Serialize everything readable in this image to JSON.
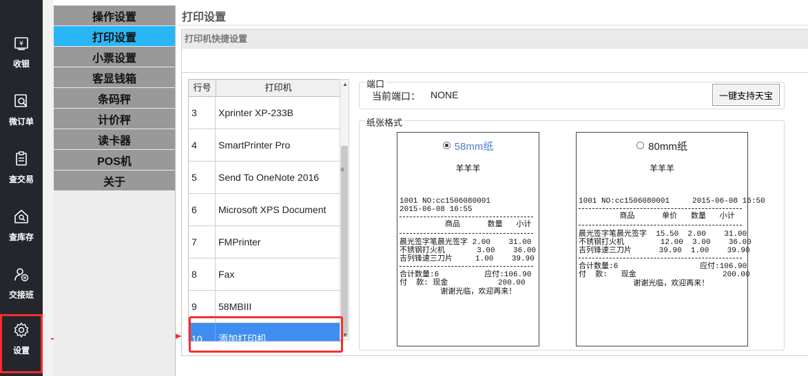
{
  "nav": {
    "items": [
      {
        "label": "收银",
        "icon": "cashier-icon"
      },
      {
        "label": "微订单",
        "icon": "order-search-icon"
      },
      {
        "label": "查交易",
        "icon": "clipboard-icon"
      },
      {
        "label": "查库存",
        "icon": "house-search-icon"
      },
      {
        "label": "交接班",
        "icon": "user-shift-icon"
      },
      {
        "label": "设置",
        "icon": "gear-icon"
      }
    ]
  },
  "categories": [
    "操作设置",
    "打印设置",
    "小票设置",
    "客显钱箱",
    "条码秤",
    "计价秤",
    "读卡器",
    "POS机",
    "关于"
  ],
  "active_category": "打印设置",
  "page": {
    "title": "打印设置",
    "quick_settings": "打印机快捷设置"
  },
  "printers": {
    "headers": {
      "no": "行号",
      "name": "打印机"
    },
    "rows": [
      {
        "no": "3",
        "name": "Xprinter XP-233B"
      },
      {
        "no": "4",
        "name": "SmartPrinter Pro"
      },
      {
        "no": "5",
        "name": "Send To OneNote 2016"
      },
      {
        "no": "6",
        "name": "Microsoft XPS Document"
      },
      {
        "no": "7",
        "name": "FMPrinter"
      },
      {
        "no": "8",
        "name": "Fax"
      },
      {
        "no": "9",
        "name": "58MBIII"
      },
      {
        "no": "10",
        "name": "添加打印机"
      }
    ],
    "selected": "10"
  },
  "port": {
    "group_title": "端口",
    "label": "当前端口：",
    "value": "NONE",
    "button": "一键支持天宝"
  },
  "paper": {
    "group_title": "纸张格式",
    "options": [
      {
        "label": "58mm纸",
        "selected": true,
        "shop": "羊羊羊",
        "line1": "1001 NO:cc1506080001",
        "line2": "2015-06-08 16:55",
        "header": "          商品      数量   小计",
        "items": [
          "晨光签字笔晨光签字 2.00    31.00",
          "不锈钢打火机       3.00    36.00",
          "吉列锋速三刀片     1.00    39.90"
        ],
        "total1": "合计数量:6          应付:106.90",
        "total2": "付  款: 现金           200.00",
        "thanks": "         谢谢光临，欢迎再来！"
      },
      {
        "label": "80mm纸",
        "selected": false,
        "shop": "羊羊羊",
        "line1": "1001 NO:cc1506080001     2015-06-08 16:50",
        "header": "         商品      单价   数量   小计",
        "items": [
          "晨光签字笔晨光签字  15.50  2.00    31.00",
          "不锈钢打火机        12.00  3.00    36.00",
          "吉列锋速三刀片      39.90  1.00    39.90"
        ],
        "total1": "合计数量:6                  应付:106.90",
        "total2": "付  款:   现金                   200.00",
        "thanks": "            谢谢光临，欢迎再来！"
      }
    ]
  },
  "colors": {
    "nav_bg": "#23262d",
    "active_category": "#29b6f6",
    "selected_row": "#3d8ef0",
    "highlight": "#ff2a2a"
  }
}
